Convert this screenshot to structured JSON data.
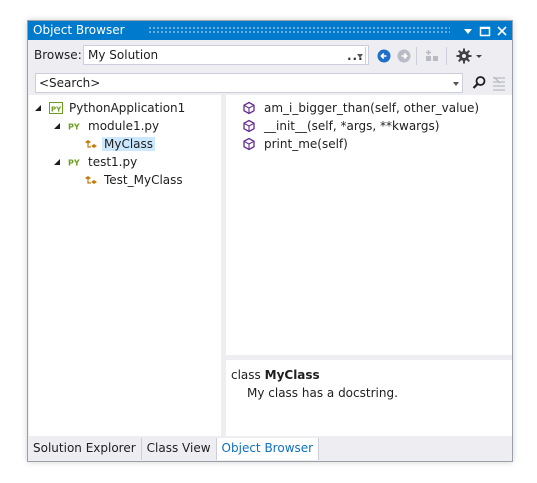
{
  "window": {
    "title": "Object Browser"
  },
  "toolbar": {
    "browse_label": "Browse:",
    "browse_value": "My Solution",
    "ellipsis_label": "..."
  },
  "search": {
    "value": "<Search>"
  },
  "tree": {
    "root": "PythonApplication1",
    "module1": "module1.py",
    "myclass": "MyClass",
    "test1": "test1.py",
    "test_myclass": "Test_MyClass"
  },
  "members": [
    "am_i_bigger_than(self, other_value)",
    "__init__(self, *args, **kwargs)",
    "print_me(self)"
  ],
  "description": {
    "keyword": "class",
    "name": "MyClass",
    "docstring": "My class has a docstring."
  },
  "tabs": [
    "Solution Explorer",
    "Class View",
    "Object Browser"
  ],
  "colors": {
    "accent": "#007acc",
    "python_green": "#6b9e1f",
    "class_icon": "#c27d0e",
    "method_icon": "#652d90",
    "selection": "#cce8ff"
  }
}
